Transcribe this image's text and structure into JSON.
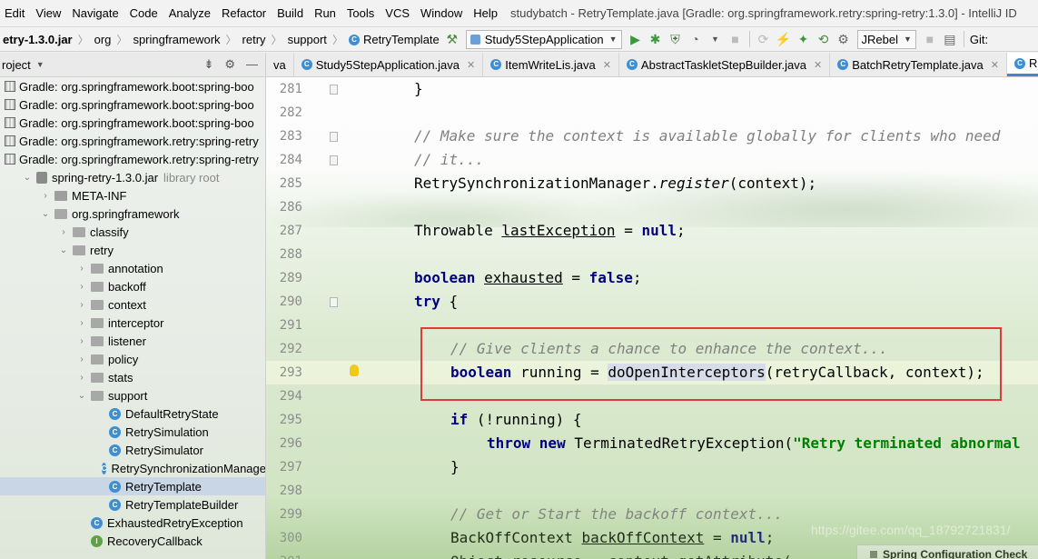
{
  "window_title": "studybatch - RetryTemplate.java [Gradle: org.springframework.retry:spring-retry:1.3.0] - IntelliJ ID",
  "menu": [
    "Edit",
    "View",
    "Navigate",
    "Code",
    "Analyze",
    "Refactor",
    "Build",
    "Run",
    "Tools",
    "VCS",
    "Window",
    "Help"
  ],
  "breadcrumb": [
    "etry-1.3.0.jar",
    "org",
    "springframework",
    "retry",
    "support",
    "RetryTemplate"
  ],
  "toolbar": {
    "run_config": "Study5StepApplication",
    "jrebel": "JRebel",
    "git": "Git:"
  },
  "project_panel": {
    "title": "roject"
  },
  "tabs": [
    {
      "label": "va",
      "active": false,
      "close": false
    },
    {
      "label": "Study5StepApplication.java",
      "active": false,
      "close": true
    },
    {
      "label": "ItemWriteLis.java",
      "active": false,
      "close": true
    },
    {
      "label": "AbstractTaskletStepBuilder.java",
      "active": false,
      "close": true
    },
    {
      "label": "BatchRetryTemplate.java",
      "active": false,
      "close": true
    },
    {
      "label": "Ret",
      "active": true,
      "close": false
    }
  ],
  "tree": [
    {
      "label": "Gradle: org.springframework.boot:spring-boo",
      "icon": "library-icon",
      "indent": 0,
      "chevron": ""
    },
    {
      "label": "Gradle: org.springframework.boot:spring-boo",
      "icon": "library-icon",
      "indent": 0,
      "chevron": ""
    },
    {
      "label": "Gradle: org.springframework.boot:spring-boo",
      "icon": "library-icon",
      "indent": 0,
      "chevron": ""
    },
    {
      "label": "Gradle: org.springframework.retry:spring-retry",
      "icon": "library-icon",
      "indent": 0,
      "chevron": ""
    },
    {
      "label": "Gradle: org.springframework.retry:spring-retry",
      "icon": "library-icon",
      "indent": 0,
      "chevron": ""
    },
    {
      "label": "spring-retry-1.3.0.jar",
      "icon": "jar-icon",
      "indent": 1,
      "chevron": "v",
      "suffix": "library root"
    },
    {
      "label": "META-INF",
      "icon": "folder-icon",
      "indent": 2,
      "chevron": ">"
    },
    {
      "label": "org.springframework",
      "icon": "package-icon",
      "indent": 2,
      "chevron": "v"
    },
    {
      "label": "classify",
      "icon": "package-icon",
      "indent": 3,
      "chevron": ">"
    },
    {
      "label": "retry",
      "icon": "package-icon",
      "indent": 3,
      "chevron": "v"
    },
    {
      "label": "annotation",
      "icon": "package-icon",
      "indent": 4,
      "chevron": ">"
    },
    {
      "label": "backoff",
      "icon": "package-icon",
      "indent": 4,
      "chevron": ">"
    },
    {
      "label": "context",
      "icon": "package-icon",
      "indent": 4,
      "chevron": ">"
    },
    {
      "label": "interceptor",
      "icon": "package-icon",
      "indent": 4,
      "chevron": ">"
    },
    {
      "label": "listener",
      "icon": "package-icon",
      "indent": 4,
      "chevron": ">"
    },
    {
      "label": "policy",
      "icon": "package-icon",
      "indent": 4,
      "chevron": ">"
    },
    {
      "label": "stats",
      "icon": "package-icon",
      "indent": 4,
      "chevron": ">"
    },
    {
      "label": "support",
      "icon": "package-icon",
      "indent": 4,
      "chevron": "v"
    },
    {
      "label": "DefaultRetryState",
      "icon": "class-icon",
      "indent": 5,
      "chevron": ""
    },
    {
      "label": "RetrySimulation",
      "icon": "class-icon",
      "indent": 5,
      "chevron": ""
    },
    {
      "label": "RetrySimulator",
      "icon": "class-icon",
      "indent": 5,
      "chevron": ""
    },
    {
      "label": "RetrySynchronizationManage",
      "icon": "class-icon",
      "indent": 5,
      "chevron": ""
    },
    {
      "label": "RetryTemplate",
      "icon": "class-icon",
      "indent": 5,
      "chevron": "",
      "selected": true
    },
    {
      "label": "RetryTemplateBuilder",
      "icon": "class-icon",
      "indent": 5,
      "chevron": ""
    },
    {
      "label": "ExhaustedRetryException",
      "icon": "exception-icon",
      "indent": 4,
      "chevron": ""
    },
    {
      "label": "RecoveryCallback",
      "icon": "interface-icon",
      "indent": 4,
      "chevron": ""
    }
  ],
  "editor": {
    "lines": [
      {
        "n": "281",
        "indent": 0,
        "tokens": [
          [
            "p",
            "}"
          ]
        ]
      },
      {
        "n": "282",
        "indent": 0,
        "tokens": []
      },
      {
        "n": "283",
        "indent": 0,
        "tokens": [
          [
            "cm",
            "// Make sure the context is available globally for clients who need"
          ]
        ]
      },
      {
        "n": "284",
        "indent": 0,
        "tokens": [
          [
            "cm",
            "// it..."
          ]
        ]
      },
      {
        "n": "285",
        "indent": 0,
        "tokens": [
          [
            "p",
            "RetrySynchronizationManager."
          ],
          [
            "it",
            "register"
          ],
          [
            "p",
            "(context);"
          ]
        ]
      },
      {
        "n": "286",
        "indent": 0,
        "tokens": []
      },
      {
        "n": "287",
        "indent": 0,
        "tokens": [
          [
            "p",
            "Throwable "
          ],
          [
            "und",
            "lastException"
          ],
          [
            "p",
            " = "
          ],
          [
            "kw",
            "null"
          ],
          [
            "p",
            ";"
          ]
        ]
      },
      {
        "n": "288",
        "indent": 0,
        "tokens": []
      },
      {
        "n": "289",
        "indent": 0,
        "tokens": [
          [
            "kw",
            "boolean "
          ],
          [
            "und",
            "exhausted"
          ],
          [
            "p",
            " = "
          ],
          [
            "kw",
            "false"
          ],
          [
            "p",
            ";"
          ]
        ]
      },
      {
        "n": "290",
        "indent": 0,
        "tokens": [
          [
            "kw",
            "try"
          ],
          [
            "p",
            " {"
          ]
        ]
      },
      {
        "n": "291",
        "indent": 0,
        "tokens": []
      },
      {
        "n": "292",
        "indent": 1,
        "tokens": [
          [
            "cm",
            "// Give clients a chance to enhance the context..."
          ]
        ]
      },
      {
        "n": "293",
        "indent": 1,
        "tokens": [
          [
            "kw",
            "boolean "
          ],
          [
            "p",
            "running = "
          ],
          [
            "hl",
            "doOpenInterceptors"
          ],
          [
            "p",
            "(retryCallback, context);"
          ]
        ]
      },
      {
        "n": "294",
        "indent": 0,
        "tokens": []
      },
      {
        "n": "295",
        "indent": 1,
        "tokens": [
          [
            "kw",
            "if"
          ],
          [
            "p",
            " (!running) {"
          ]
        ]
      },
      {
        "n": "296",
        "indent": 2,
        "tokens": [
          [
            "kw",
            "throw new "
          ],
          [
            "p",
            "TerminatedRetryException("
          ],
          [
            "str",
            "\"Retry terminated abnormal"
          ]
        ]
      },
      {
        "n": "297",
        "indent": 1,
        "tokens": [
          [
            "p",
            "}"
          ]
        ]
      },
      {
        "n": "298",
        "indent": 0,
        "tokens": []
      },
      {
        "n": "299",
        "indent": 1,
        "tokens": [
          [
            "cm",
            "// Get or Start the backoff context..."
          ]
        ]
      },
      {
        "n": "300",
        "indent": 1,
        "tokens": [
          [
            "p",
            "BackOffContext "
          ],
          [
            "und",
            "backOffContext"
          ],
          [
            "p",
            " = "
          ],
          [
            "kw",
            "null"
          ],
          [
            "p",
            ";"
          ]
        ]
      },
      {
        "n": "301",
        "indent": 1,
        "tokens": [
          [
            "p",
            "Object resource = context.getAttribute("
          ]
        ]
      }
    ]
  },
  "watermark": "https://gitee.com/qq_18792721831/",
  "notification": "Spring Configuration Check"
}
